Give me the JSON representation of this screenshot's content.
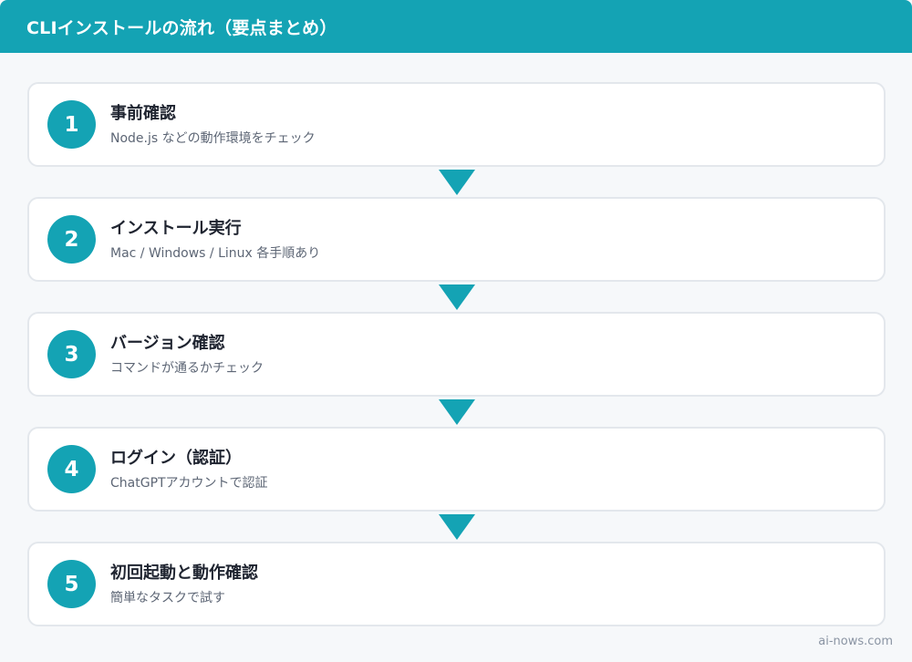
{
  "header": {
    "title": "CLIインストールの流れ（要点まとめ）"
  },
  "steps": [
    {
      "number": "1",
      "title": "事前確認",
      "description": "Node.js などの動作環境をチェック"
    },
    {
      "number": "2",
      "title": "インストール実行",
      "description": "Mac / Windows / Linux 各手順あり"
    },
    {
      "number": "3",
      "title": "バージョン確認",
      "description": "コマンドが通るかチェック"
    },
    {
      "number": "4",
      "title": "ログイン（認証）",
      "description": "ChatGPTアカウントで認証"
    },
    {
      "number": "5",
      "title": "初回起動と動作確認",
      "description": "簡単なタスクで試す"
    }
  ],
  "footer": {
    "credit": "ai-nows.com"
  },
  "colors": {
    "accent": "#14a3b4",
    "background": "#f6f8fa",
    "card": "#ffffff"
  },
  "icons": {
    "connector": "arrow-down-icon"
  }
}
